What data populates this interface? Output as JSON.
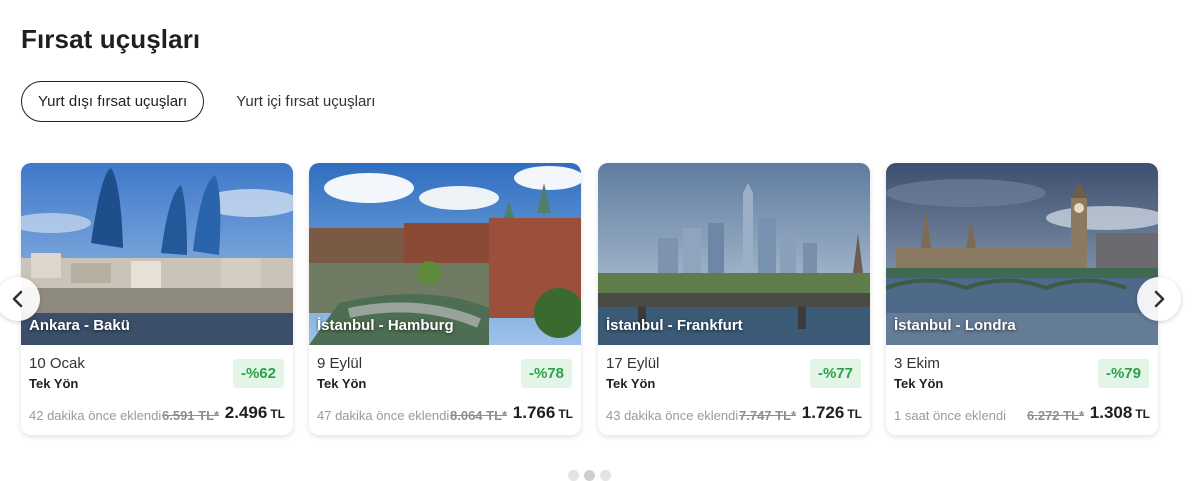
{
  "page": {
    "title": "Fırsat uçuşları"
  },
  "tabs": [
    {
      "label": "Yurt dışı fırsat uçuşları",
      "active": true
    },
    {
      "label": "Yurt içi fırsat uçuşları",
      "active": false
    }
  ],
  "cards": [
    {
      "route": "Ankara - Bakü",
      "date": "10 Ocak",
      "trip": "Tek Yön",
      "discount": "-%62",
      "added": "42 dakika önce eklendi",
      "old_price": "6.591 TL*",
      "price": "2.496",
      "currency": "TL"
    },
    {
      "route": "İstanbul - Hamburg",
      "date": "9 Eylül",
      "trip": "Tek Yön",
      "discount": "-%78",
      "added": "47 dakika önce eklendi",
      "old_price": "8.064 TL*",
      "price": "1.766",
      "currency": "TL"
    },
    {
      "route": "İstanbul - Frankfurt",
      "date": "17 Eylül",
      "trip": "Tek Yön",
      "discount": "-%77",
      "added": "43 dakika önce eklendi",
      "old_price": "7.747 TL*",
      "price": "1.726",
      "currency": "TL"
    },
    {
      "route": "İstanbul - Londra",
      "date": "3 Ekim",
      "trip": "Tek Yön",
      "discount": "-%79",
      "added": "1 saat önce eklendi",
      "old_price": "6.272 TL*",
      "price": "1.308",
      "currency": "TL"
    }
  ],
  "carousel": {
    "prev_icon": "chevron-left-icon",
    "next_icon": "chevron-right-icon",
    "page_count": 3,
    "current_page": 2
  },
  "colors": {
    "discount_bg": "#e3f5e6",
    "discount_text": "#2aa14a",
    "muted_text": "#9a9a9a"
  }
}
